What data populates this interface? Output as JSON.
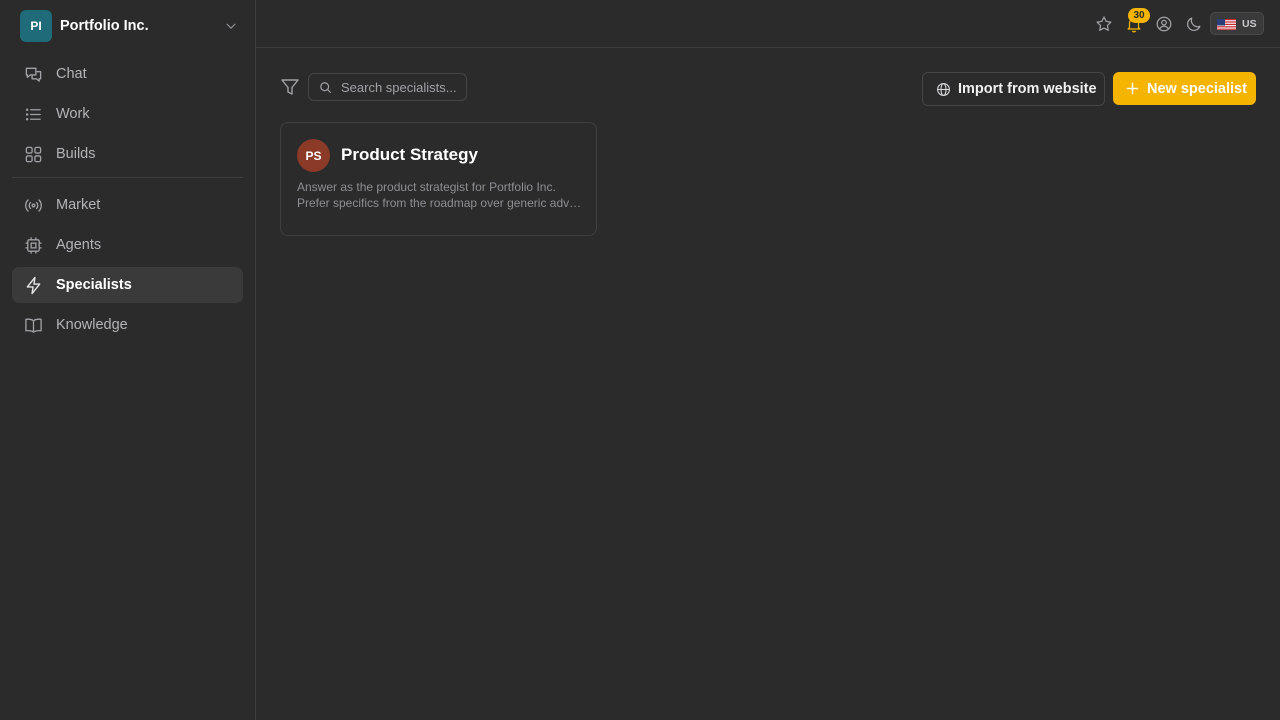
{
  "org": {
    "initials": "PI",
    "name": "Portfolio Inc."
  },
  "nav": {
    "primary": [
      {
        "label": "Chat",
        "icon": "chat-icon"
      },
      {
        "label": "Work",
        "icon": "list-icon"
      },
      {
        "label": "Builds",
        "icon": "grid-icon"
      }
    ],
    "secondary": [
      {
        "label": "Market",
        "icon": "broadcast-icon"
      },
      {
        "label": "Agents",
        "icon": "chip-icon"
      },
      {
        "label": "Specialists",
        "icon": "lightning-icon",
        "active": true
      },
      {
        "label": "Knowledge",
        "icon": "book-icon"
      }
    ]
  },
  "topbar": {
    "notification_count": "30",
    "locale": "US",
    "icons": [
      "star-icon",
      "bell-icon",
      "user-circle-icon",
      "moon-icon",
      "us-flag-icon"
    ]
  },
  "toolbar": {
    "search_placeholder": "Search specialists...",
    "import_label": "Import from website",
    "new_label": "New specialist"
  },
  "cards": [
    {
      "initials": "PS",
      "title": "Product Strategy",
      "desc_line1": "Answer as the product strategist for Portfolio Inc.",
      "desc_line2": "Prefer specifics from the roadmap over generic advice."
    }
  ],
  "colors": {
    "background": "#2b2b2b",
    "accent": "#f5b400",
    "org_avatar": "#1f6b7a",
    "card_avatar": "#8b3a28"
  }
}
